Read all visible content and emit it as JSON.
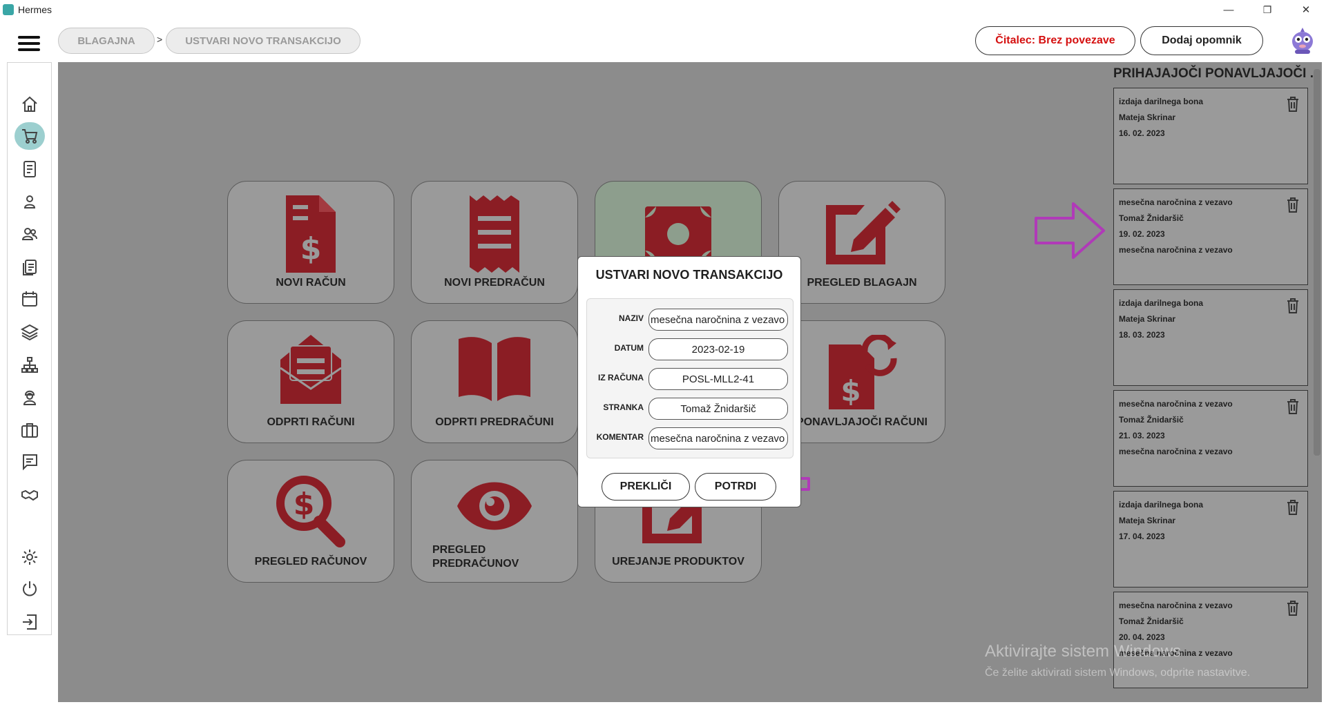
{
  "window": {
    "title": "Hermes",
    "minimize": "—",
    "maximize": "❐",
    "close": "✕"
  },
  "breadcrumb": {
    "items": [
      "BLAGAJNA",
      "USTVARI NOVO TRANSAKCIJO"
    ],
    "separator": ">"
  },
  "header": {
    "reader_status": "Čitalec: Brez povezave",
    "add_reminder": "Dodaj opomnik"
  },
  "sidebar": {
    "items": [
      "home-icon",
      "cart-icon",
      "document-icon",
      "user-icon",
      "users-icon",
      "list-icon",
      "calendar-icon",
      "layers-icon",
      "sitemap-icon",
      "worker-icon",
      "briefcase-icon",
      "chat-icon",
      "handshake-icon",
      "gear-icon",
      "power-icon",
      "logout-icon"
    ],
    "active": "cart-icon"
  },
  "tiles": [
    {
      "label": "NOVI RAČUN",
      "icon": "invoice-dollar-icon"
    },
    {
      "label": "NOVI PREDRAČUN",
      "icon": "receipt-icon"
    },
    {
      "label": "",
      "icon": "money-bill-icon"
    },
    {
      "label": "PREGLED BLAGAJN",
      "icon": "edit-icon"
    },
    {
      "label": "ODPRTI RAČUNI",
      "icon": "open-envelope-icon"
    },
    {
      "label": "ODPRTI PREDRAČUNI",
      "icon": "open-book-icon"
    },
    {
      "label": "PONAVLJAJOČI RAČUNI",
      "icon": "recurring-invoice-icon"
    },
    {
      "label": "PREGLED RAČUNOV",
      "icon": "search-dollar-icon"
    },
    {
      "label_line1": "PREGLED",
      "label_line2": "PREDRAČUNOV",
      "icon": "eye-icon"
    },
    {
      "label": "UREJANJE PRODUKTOV",
      "icon": "edit-icon"
    }
  ],
  "right_panel": {
    "title": "PRIHAJAJOČI PONAVLJAJOČI ...",
    "cards": [
      {
        "name": "izdaja darilnega bona",
        "client": "Mateja Skrinar",
        "date": "16. 02. 2023",
        "comment": ""
      },
      {
        "name": "mesečna naročnina z vezavo",
        "client": "Tomaž Žnidaršič",
        "date": "19. 02. 2023",
        "comment": "mesečna naročnina z vezavo"
      },
      {
        "name": "izdaja darilnega bona",
        "client": "Mateja Skrinar",
        "date": "18. 03. 2023",
        "comment": ""
      },
      {
        "name": "mesečna naročnina z vezavo",
        "client": "Tomaž Žnidaršič",
        "date": "21. 03. 2023",
        "comment": "mesečna naročnina z vezavo"
      },
      {
        "name": "izdaja darilnega bona",
        "client": "Mateja Skrinar",
        "date": "17. 04. 2023",
        "comment": ""
      },
      {
        "name": "mesečna naročnina z vezavo",
        "client": "Tomaž Žnidaršič",
        "date": "20. 04. 2023",
        "comment": "mesečna naročnina z vezavo"
      }
    ]
  },
  "dialog": {
    "title": "USTVARI NOVO TRANSAKCIJO",
    "fields": [
      {
        "label": "NAZIV",
        "value": "mesečna naročnina z vezavo"
      },
      {
        "label": "DATUM",
        "value": "2023-02-19"
      },
      {
        "label": "IZ RAČUNA",
        "value": "POSL-MLL2-41"
      },
      {
        "label": "STRANKA",
        "value": "Tomaž Žnidaršič"
      },
      {
        "label": "KOMENTAR",
        "value": "mesečna naročnina z vezavo"
      }
    ],
    "cancel": "PREKLIČI",
    "confirm": "POTRDI"
  },
  "watermark": {
    "line1": "Aktivirajte sistem Windows",
    "line2": "Če želite aktivirati sistem Windows, odprite nastavitve."
  },
  "colors": {
    "accent_red": "#8b1d24",
    "annotation_purple": "#b03ab8",
    "teal": "#9ccfcf"
  }
}
